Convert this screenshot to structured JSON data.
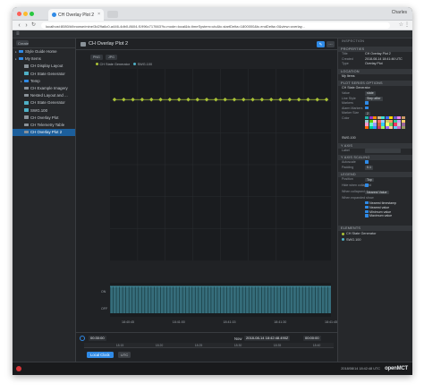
{
  "browser": {
    "tab_title": "CH Overlay Plot 2",
    "profile": "Charles",
    "url": "localhost:8080/#/browse/mine/3d29a6c0-a446-4db0-8604-f1996c717663?tc.mode=local&tc.timeSystem=utc&tc.startDelta=1800000&tc.endDelta=0&view=overlay..."
  },
  "tree": {
    "create_label": "Create",
    "items": [
      {
        "label": "Style Guide Home",
        "color": "#2f8ae6",
        "level": 0
      },
      {
        "label": "My Items",
        "color": "#2f8ae6",
        "level": 0
      },
      {
        "label": "CH Display Layout",
        "color": "#8a9299",
        "level": 1
      },
      {
        "label": "CH State Generator",
        "color": "#4fb0c6",
        "level": 1
      },
      {
        "label": "Temp",
        "color": "#2f8ae6",
        "level": 1
      },
      {
        "label": "CH Example Imagery",
        "color": "#8a9299",
        "level": 1
      },
      {
        "label": "Nested Layout and ...",
        "color": "#8a9299",
        "level": 1
      },
      {
        "label": "CH State Generator",
        "color": "#4fb0c6",
        "level": 1
      },
      {
        "label": "SWG.100",
        "color": "#4fb0c6",
        "level": 1
      },
      {
        "label": "CH Overlay Plot",
        "color": "#8a9299",
        "level": 1
      },
      {
        "label": "CH Telemetry Table",
        "color": "#8a9299",
        "level": 1
      },
      {
        "label": "CH Overlay Plot 2",
        "color": "#8a9299",
        "level": 1,
        "selected": true
      }
    ]
  },
  "main": {
    "title": "CH Overlay Plot 2",
    "toolbar": [
      "PNG",
      "JPG"
    ],
    "legend": [
      {
        "name": "CH State Generator",
        "color": "#aac236"
      },
      {
        "name": "SWG.100",
        "color": "#4fb0c6"
      }
    ]
  },
  "chart_data": [
    {
      "type": "scatter",
      "series": [
        {
          "name": "CH State Generator",
          "color": "#aac236",
          "y_level": 0.84,
          "marker": "diamond-line"
        }
      ],
      "x": [
        "18:40:45",
        "18:41:00",
        "18:41:15",
        "18:41:30",
        "18:41:45"
      ],
      "title": "",
      "xlabel": "",
      "ylabel": ""
    },
    {
      "type": "bar",
      "series": [
        {
          "name": "SWG.100",
          "color": "#4fb0c6"
        }
      ],
      "yticks": [
        "ON",
        "OFF"
      ],
      "x": [
        "18:40:45",
        "18:41:00",
        "18:41:15",
        "18:41:30",
        "18:41:45"
      ]
    }
  ],
  "time_conductor": {
    "start_label": "Start",
    "start_value": "00:30:00",
    "now_label": "Now",
    "now_value": "2018-08-14 18:42:48.490Z",
    "end_value": "00:00:00",
    "ticks": [
      "18:15",
      "18:20",
      "18:25",
      "18:30",
      "18:35",
      "18:40"
    ],
    "clock_label": "Local Clock",
    "timesystem": "UTC"
  },
  "inspector": {
    "title": "INSPECTION",
    "properties_header": "PROPERTIES",
    "properties": [
      {
        "k": "Title",
        "v": "CH Overlay Plot 2"
      },
      {
        "k": "Created",
        "v": "2018-08-14 18:41:46 UTC"
      },
      {
        "k": "Type",
        "v": "Overlay Plot"
      }
    ],
    "location_header": "LOCATION",
    "location": "My Items",
    "series_header": "PLOT SERIES OPTIONS",
    "series_name": "CH State Generator",
    "series_opts": [
      {
        "k": "Value",
        "v": "state"
      },
      {
        "k": "Line Style",
        "v": "Step after"
      },
      {
        "k": "Markers",
        "v": ""
      },
      {
        "k": "Alarm Markers",
        "v": ""
      },
      {
        "k": "Marker Size",
        "v": "2"
      }
    ],
    "color_label": "Color",
    "second_series": "SWG.100",
    "yaxis_header": "Y AXIS",
    "yaxis_label_key": "Label",
    "yaxis_scaling_header": "Y AXIS SCALING",
    "autoscale_key": "Autoscale",
    "padding_key": "Padding",
    "padding_value": "0.1",
    "legend_header": "LEGEND",
    "legend_opts": [
      {
        "k": "Position",
        "v": "Top"
      },
      {
        "k": "Hide when collapsed",
        "v": ""
      },
      {
        "k": "When collapsed show",
        "v": "Nearest Value"
      }
    ],
    "expanded_key": "When expanded show",
    "expanded_opts": [
      "Nearest timestamp",
      "Nearest value",
      "Minimum value",
      "Maximum value"
    ],
    "elements_header": "ELEMENTS",
    "elements": [
      {
        "name": "CH State Generator",
        "color": "#aac236"
      },
      {
        "name": "SWG.100",
        "color": "#4fb0c6"
      }
    ],
    "swatches": [
      "#20b2aa",
      "#9932cc",
      "#ff8c00",
      "#d2b48c",
      "#40e0d0",
      "#4169ff",
      "#ffd700",
      "#6a5acd",
      "#ee82ee",
      "#cc9966",
      "#99cccc",
      "#66cc00",
      "#ffcccc",
      "#ff6666",
      "#99ccff",
      "#cccc66",
      "#ff9966",
      "#33cc99",
      "#cc99ff",
      "#ffcc66",
      "#ff99cc",
      "#66ffcc",
      "#9999ff",
      "#cc6633",
      "#33ccff",
      "#ffff66",
      "#66cc66",
      "#ff3366",
      "#cccccc",
      "#996699",
      "#ff6600",
      "#00cc99",
      "#3399ff",
      "#cc3366",
      "#99ff66",
      "#9966ff",
      "#ffcc99",
      "#66ccff",
      "#cc66cc",
      "#999966"
    ]
  },
  "status": {
    "time": "2018/08/14 18:42:48 UTC",
    "logo": "openMCT"
  }
}
